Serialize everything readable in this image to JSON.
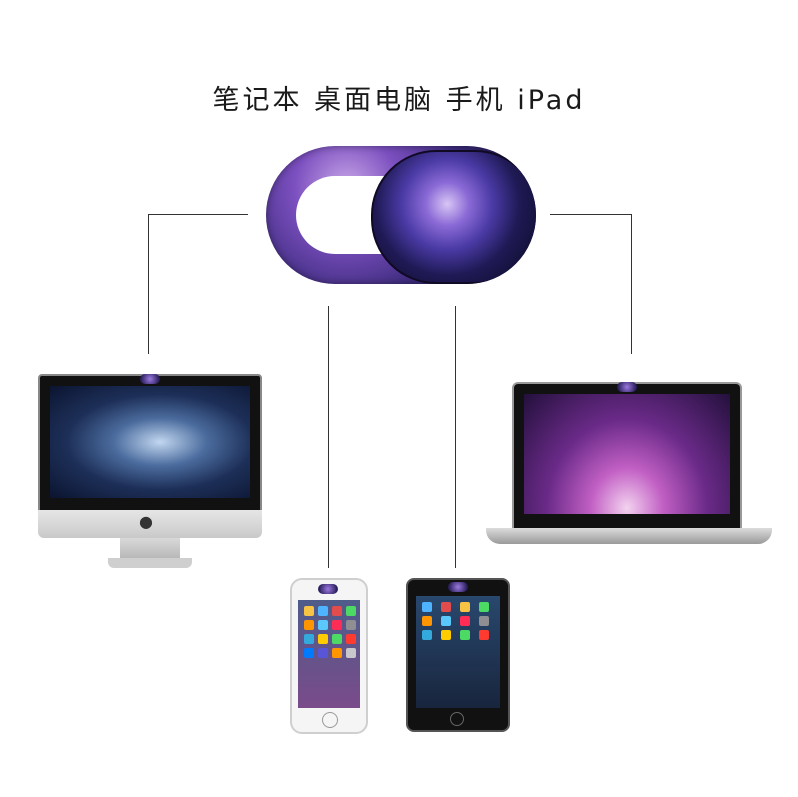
{
  "caption": {
    "text": "笔记本 桌面电脑 手机 iPad"
  },
  "colors": {
    "cover_primary": "#7b4fbf",
    "cover_dark": "#160f33",
    "line": "#333333"
  },
  "icons": {
    "brand": "apple-logo-icon",
    "device_iconset": "app-grid-icon"
  }
}
